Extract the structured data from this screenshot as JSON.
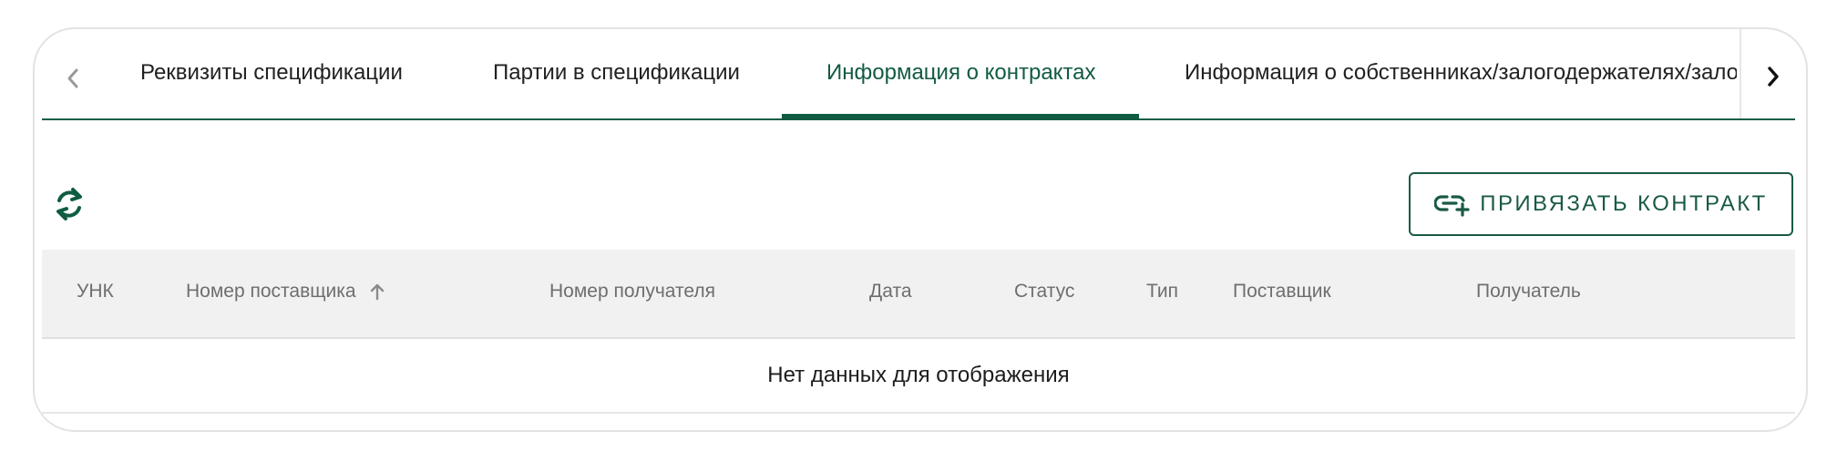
{
  "tabs": {
    "items": [
      {
        "label": "Реквизиты спецификации",
        "active": false
      },
      {
        "label": "Партии в спецификации",
        "active": false
      },
      {
        "label": "Информация о контрактах",
        "active": true
      },
      {
        "label": "Информация о собственниках/залогодержателях/залогодателях",
        "active": false
      }
    ],
    "left_arrow_icon": "chevron-left-icon",
    "right_arrow_icon": "chevron-right-icon"
  },
  "toolbar": {
    "refresh_icon": "refresh-icon",
    "bind_contract_label": "ПРИВЯЗАТЬ КОНТРАКТ",
    "bind_contract_icon": "link-add-icon"
  },
  "table": {
    "columns": [
      "УНК",
      "Номер поставщика",
      "Номер получателя",
      "Дата",
      "Статус",
      "Тип",
      "Поставщик",
      "Получатель"
    ],
    "sort_column": "Номер поставщика",
    "sort_direction": "asc",
    "empty_message": "Нет данных для отображения"
  },
  "colors": {
    "accent": "#0f5c42",
    "header_bg": "#f1f1f1",
    "header_text": "#6e6e6e"
  }
}
